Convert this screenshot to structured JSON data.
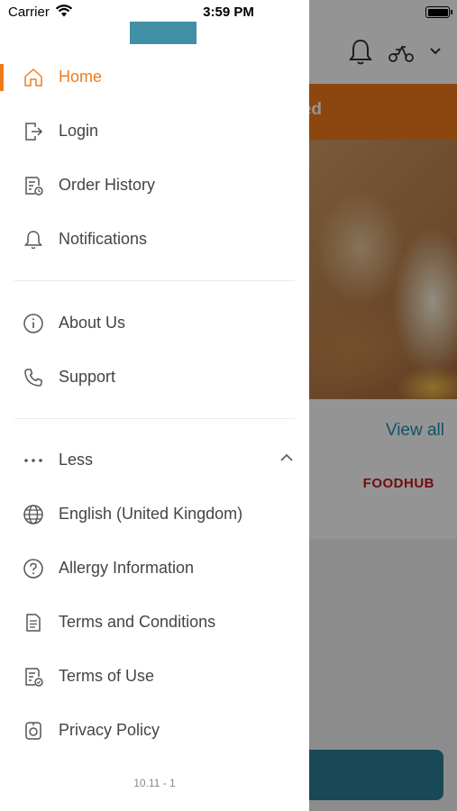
{
  "status_bar": {
    "carrier": "Carrier",
    "time": "3:59 PM"
  },
  "background": {
    "banner_text": "ed",
    "view_all": "View all",
    "logo_text": "FOODHUB",
    "brand_color": "#f07b1a",
    "link_color": "#1b8fb3"
  },
  "drawer": {
    "menu_group_1": [
      {
        "label": "Home",
        "icon": "home-icon",
        "active": true
      },
      {
        "label": "Login",
        "icon": "login-icon"
      },
      {
        "label": "Order History",
        "icon": "order-history-icon"
      },
      {
        "label": "Notifications",
        "icon": "bell-icon"
      }
    ],
    "menu_group_2": [
      {
        "label": "About Us",
        "icon": "info-icon"
      },
      {
        "label": "Support",
        "icon": "phone-icon"
      }
    ],
    "menu_group_3": [
      {
        "label": "Less",
        "icon": "more-dots-icon",
        "expanded": true
      },
      {
        "label": "English (United Kingdom)",
        "icon": "globe-icon"
      },
      {
        "label": "Allergy Information",
        "icon": "question-icon"
      },
      {
        "label": "Terms and Conditions",
        "icon": "document-icon"
      },
      {
        "label": "Terms of Use",
        "icon": "document-check-icon"
      },
      {
        "label": "Privacy Policy",
        "icon": "privacy-icon"
      }
    ],
    "version": "10.11 - 1",
    "active_color": "#f07b1a"
  }
}
